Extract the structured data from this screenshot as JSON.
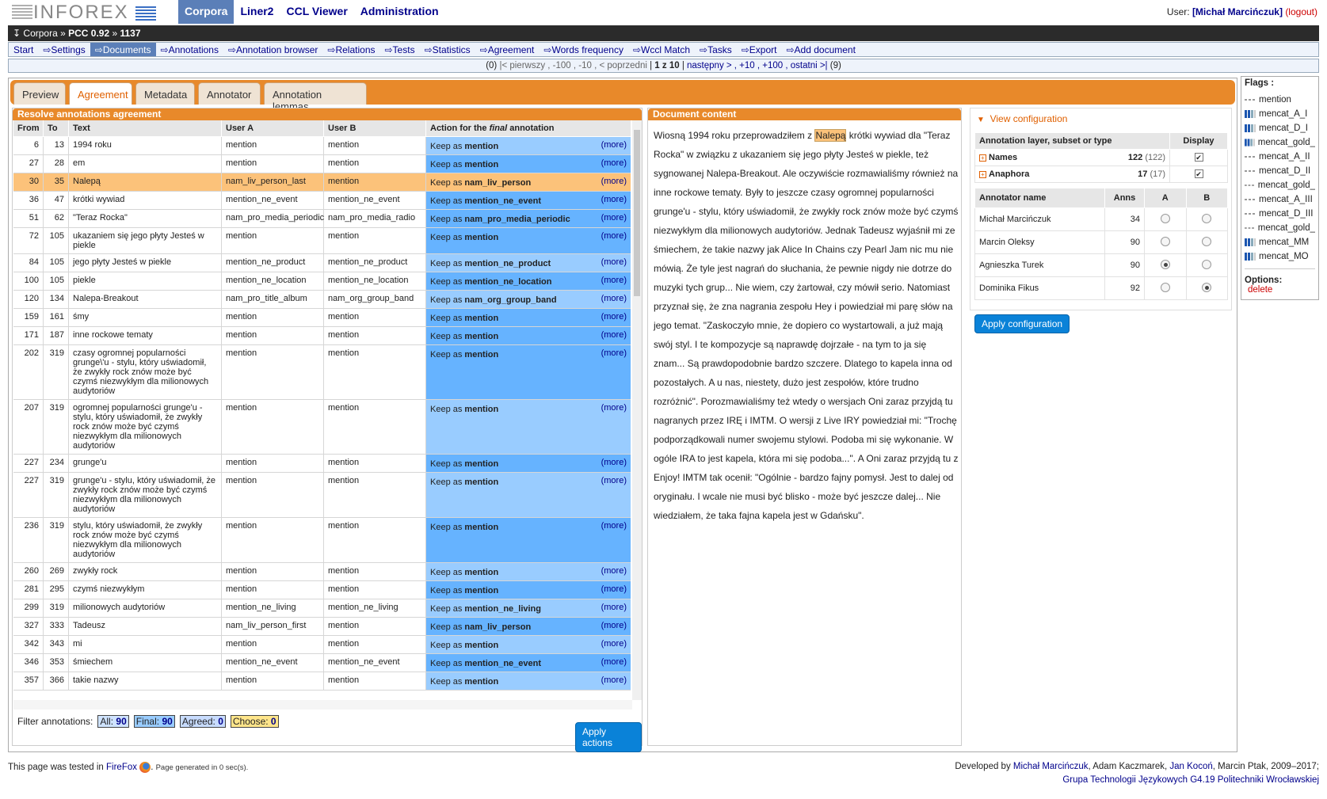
{
  "app": {
    "logo_text": "INFOREX"
  },
  "nav": [
    {
      "label": "Corpora",
      "active": true
    },
    {
      "label": "Liner2"
    },
    {
      "label": "CCL Viewer"
    },
    {
      "label": "Administration"
    }
  ],
  "user": {
    "prefix": "User: ",
    "name": "[Michał Marcińczuk]",
    "logout": "(logout)"
  },
  "breadcrumb": {
    "arrow": "↧",
    "corpora": "Corpora",
    "sep1": " » ",
    "corpus": "PCC 0.92",
    "sep2": " » ",
    "doc": "1137"
  },
  "submenu": [
    {
      "label": "Start"
    },
    {
      "label": "⇨Settings"
    },
    {
      "label": "⇨Documents",
      "active": true
    },
    {
      "label": "⇨Annotations"
    },
    {
      "label": "⇨Annotation browser"
    },
    {
      "label": "⇨Relations"
    },
    {
      "label": "⇨Tests"
    },
    {
      "label": "⇨Statistics"
    },
    {
      "label": "⇨Agreement"
    },
    {
      "label": "⇨Words frequency"
    },
    {
      "label": "⇨Wccl Match"
    },
    {
      "label": "⇨Tasks"
    },
    {
      "label": "⇨Export"
    },
    {
      "label": "⇨Add document"
    }
  ],
  "pager": {
    "prev_count": "(0)",
    "prev": "|< pierwszy , -100 , -10 , < poprzedni",
    "current": "1 z 10",
    "next": "następny > , +10 , +100 , ostatni >|",
    "next_count": "(9)"
  },
  "tabs": [
    {
      "label": "Preview"
    },
    {
      "label": "Agreement",
      "active": true
    },
    {
      "label": "Metadata"
    },
    {
      "label": "Annotator"
    },
    {
      "label": "Annotation lemmas"
    }
  ],
  "left": {
    "title": "Resolve annotations agreement",
    "headers": {
      "from": "From",
      "to": "To",
      "text": "Text",
      "user_a": "User A",
      "user_b": "User B",
      "action_pre": "Action for the ",
      "action_em": "final",
      "action_post": " annotation"
    },
    "keep_label": "Keep as ",
    "more_label": "(more)",
    "rows": [
      {
        "from": "6",
        "to": "13",
        "text": "1994 roku",
        "a": "mention",
        "b": "mention",
        "keep": "mention",
        "dark": false
      },
      {
        "from": "27",
        "to": "28",
        "text": "em",
        "a": "mention",
        "b": "mention",
        "keep": "mention",
        "dark": true
      },
      {
        "from": "30",
        "to": "35",
        "text": "Nalepą",
        "a": "nam_liv_person_last",
        "b": "mention",
        "keep": "nam_liv_person",
        "hl": true
      },
      {
        "from": "36",
        "to": "47",
        "text": "krótki wywiad",
        "a": "mention_ne_event",
        "b": "mention_ne_event",
        "keep": "mention_ne_event",
        "dark": true
      },
      {
        "from": "51",
        "to": "62",
        "text": "\"Teraz Rocka\"",
        "a": "nam_pro_media_periodic",
        "b": "nam_pro_media_radio",
        "keep": "nam_pro_media_periodic",
        "dark": true
      },
      {
        "from": "72",
        "to": "105",
        "text": "ukazaniem się jego płyty Jesteś w piekle",
        "a": "mention",
        "b": "mention",
        "keep": "mention",
        "dark": true
      },
      {
        "from": "84",
        "to": "105",
        "text": "jego płyty Jesteś w piekle",
        "a": "mention_ne_product",
        "b": "mention_ne_product",
        "keep": "mention_ne_product",
        "dark": false
      },
      {
        "from": "100",
        "to": "105",
        "text": "piekle",
        "a": "mention_ne_location",
        "b": "mention_ne_location",
        "keep": "mention_ne_location",
        "dark": true
      },
      {
        "from": "120",
        "to": "134",
        "text": "Nalepa-Breakout",
        "a": "nam_pro_title_album",
        "b": "nam_org_group_band",
        "keep": "nam_org_group_band",
        "dark": false
      },
      {
        "from": "159",
        "to": "161",
        "text": "śmy",
        "a": "mention",
        "b": "mention",
        "keep": "mention",
        "dark": true
      },
      {
        "from": "171",
        "to": "187",
        "text": "inne rockowe tematy",
        "a": "mention",
        "b": "mention",
        "keep": "mention",
        "dark": true
      },
      {
        "from": "202",
        "to": "319",
        "text": "czasy ogromnej popularności grunge\\'u - stylu, który uświadomił, że zwykły rock znów może być czymś niezwykłym dla milionowych audytoriów",
        "a": "mention",
        "b": "mention",
        "keep": "mention",
        "dark": true
      },
      {
        "from": "207",
        "to": "319",
        "text": "ogromnej popularności grunge'u - stylu, który uświadomił, że zwykły rock znów może być czymś niezwykłym dla milionowych audytoriów",
        "a": "mention",
        "b": "mention",
        "keep": "mention",
        "dark": false
      },
      {
        "from": "227",
        "to": "234",
        "text": "grunge'u",
        "a": "mention",
        "b": "mention",
        "keep": "mention",
        "dark": true
      },
      {
        "from": "227",
        "to": "319",
        "text": "grunge'u - stylu, który uświadomił, że zwykły rock znów może być czymś niezwykłym dla milionowych audytoriów",
        "a": "mention",
        "b": "mention",
        "keep": "mention",
        "dark": false
      },
      {
        "from": "236",
        "to": "319",
        "text": "stylu, który uświadomił, że zwykły rock znów może być czymś niezwykłym dla milionowych audytoriów",
        "a": "mention",
        "b": "mention",
        "keep": "mention",
        "dark": true
      },
      {
        "from": "260",
        "to": "269",
        "text": "zwykły rock",
        "a": "mention",
        "b": "mention",
        "keep": "mention",
        "dark": false
      },
      {
        "from": "281",
        "to": "295",
        "text": "czymś niezwykłym",
        "a": "mention",
        "b": "mention",
        "keep": "mention",
        "dark": true
      },
      {
        "from": "299",
        "to": "319",
        "text": "milionowych audytoriów",
        "a": "mention_ne_living",
        "b": "mention_ne_living",
        "keep": "mention_ne_living",
        "dark": false
      },
      {
        "from": "327",
        "to": "333",
        "text": "Tadeusz",
        "a": "nam_liv_person_first",
        "b": "mention",
        "keep": "nam_liv_person",
        "dark": true
      },
      {
        "from": "342",
        "to": "343",
        "text": "mi",
        "a": "mention",
        "b": "mention",
        "keep": "mention",
        "dark": false
      },
      {
        "from": "346",
        "to": "353",
        "text": "śmiechem",
        "a": "mention_ne_event",
        "b": "mention_ne_event",
        "keep": "mention_ne_event",
        "dark": true
      },
      {
        "from": "357",
        "to": "366",
        "text": "takie nazwy",
        "a": "mention",
        "b": "mention",
        "keep": "mention",
        "dark": false
      }
    ],
    "filter": {
      "label": "Filter annotations:",
      "all": "All:",
      "all_n": "90",
      "final": "Final:",
      "final_n": "90",
      "agreed": "Agreed:",
      "agreed_n": "0",
      "choose": "Choose:",
      "choose_n": "0"
    },
    "apply_actions": "Apply actions"
  },
  "doc": {
    "title": "Document content",
    "before": "Wiosną 1994 roku przeprowadziłem z ",
    "highlight": "Nalepą",
    "after": " krótki wywiad dla \"Teraz Rocka\" w związku z ukazaniem się jego płyty Jesteś w piekle, też sygnowanej Nalepa-Breakout. Ale oczywiście rozmawialiśmy również na inne rockowe tematy. Były to jeszcze czasy ogromnej popularności grunge'u - stylu, który uświadomił, że zwykły rock znów może być czymś niezwykłym dla milionowych audytoriów. Jednak Tadeusz wyjaśnił mi ze śmiechem, że takie nazwy jak Alice In Chains czy Pearl Jam nic mu nie mówią. Że tyle jest nagrań do słuchania, że pewnie nigdy nie dotrze do muzyki tych grup... Nie wiem, czy żartował, czy mówił serio. Natomiast przyznał się, że zna nagrania zespołu Hey i powiedział mi parę słów na jego temat. \"Zaskoczyło mnie, że dopiero co wystartowali, a już mają swój styl. I te kompozycje są naprawdę dojrzałe - na tym to ja się znam... Są prawdopodobnie bardzo szczere. Dlatego to kapela inna od pozostałych. A u nas, niestety, dużo jest zespołów, które trudno rozróżnić\". Porozmawialiśmy też wtedy o wersjach Oni zaraz przyjdą tu nagranych przez IRĘ i IMTM. O wersji z Live IRY powiedział mi: \"Trochę podporządkowali numer swojemu stylowi. Podoba mi się wykonanie. W ogóle IRA to jest kapela, która mi się podoba...\". A Oni zaraz przyjdą tu z Enjoy! IMTM tak ocenił: \"Ogólnie - bardzo fajny pomysł. Jest to dalej od oryginału. I wcale nie musi być blisko - może być jeszcze dalej... Nie wiedziałem, że taka fajna kapela jest w Gdańsku\"."
  },
  "config": {
    "title": "View configuration",
    "layer_header": "Annotation layer, subset or type",
    "display_header": "Display",
    "layers": [
      {
        "name": "Names",
        "count": "122",
        "total": "(122)"
      },
      {
        "name": "Anaphora",
        "count": "17",
        "total": "(17)"
      }
    ],
    "annot_headers": {
      "name": "Annotator name",
      "anns": "Anns",
      "a": "A",
      "b": "B"
    },
    "annotators": [
      {
        "name": "Michał Marcińczuk",
        "anns": "34",
        "a": false,
        "b": false
      },
      {
        "name": "Marcin Oleksy",
        "anns": "90",
        "a": false,
        "b": false
      },
      {
        "name": "Agnieszka Turek",
        "anns": "90",
        "a": true,
        "b": false
      },
      {
        "name": "Dominika Fikus",
        "anns": "92",
        "a": false,
        "b": true
      }
    ],
    "apply": "Apply configuration"
  },
  "flags": {
    "title": "Flags",
    "items": [
      {
        "label": "mention",
        "icon": "dots"
      },
      {
        "label": "mencat_A_I",
        "icon": "bars"
      },
      {
        "label": "mencat_D_I",
        "icon": "bars"
      },
      {
        "label": "mencat_gold_",
        "icon": "bars"
      },
      {
        "label": "mencat_A_II",
        "icon": "dots"
      },
      {
        "label": "mencat_D_II",
        "icon": "dots"
      },
      {
        "label": "mencat_gold_",
        "icon": "dots"
      },
      {
        "label": "mencat_A_III",
        "icon": "dots"
      },
      {
        "label": "mencat_D_III",
        "icon": "dots"
      },
      {
        "label": "mencat_gold_",
        "icon": "dots"
      },
      {
        "label": "mencat_MM",
        "icon": "bars"
      },
      {
        "label": "mencat_MO",
        "icon": "bars"
      }
    ],
    "options_label": "Options:",
    "delete": "delete"
  },
  "footer": {
    "tested_pre": "This page was tested in ",
    "browser": "FireFox",
    "tested_post": ". ",
    "generated": "Page generated in 0 sec(s).",
    "dev_pre": "Developed by ",
    "dev1": "Michał Marcińczuk",
    "dev_mid1": ", Adam Kaczmarek, ",
    "dev2": "Jan Kocoń",
    "dev_post": ", Marcin Ptak, 2009–2017;",
    "group": "Grupa Technologii Językowych G4.19 Politechniki Wrocławskiej"
  },
  "colors": {
    "accent": "#e8892a",
    "nav_active": "#5b7fb8",
    "keep_light": "#99ccff",
    "keep_dark": "#66b3ff",
    "highlight": "#fcc27a",
    "button": "#0a82d8"
  }
}
